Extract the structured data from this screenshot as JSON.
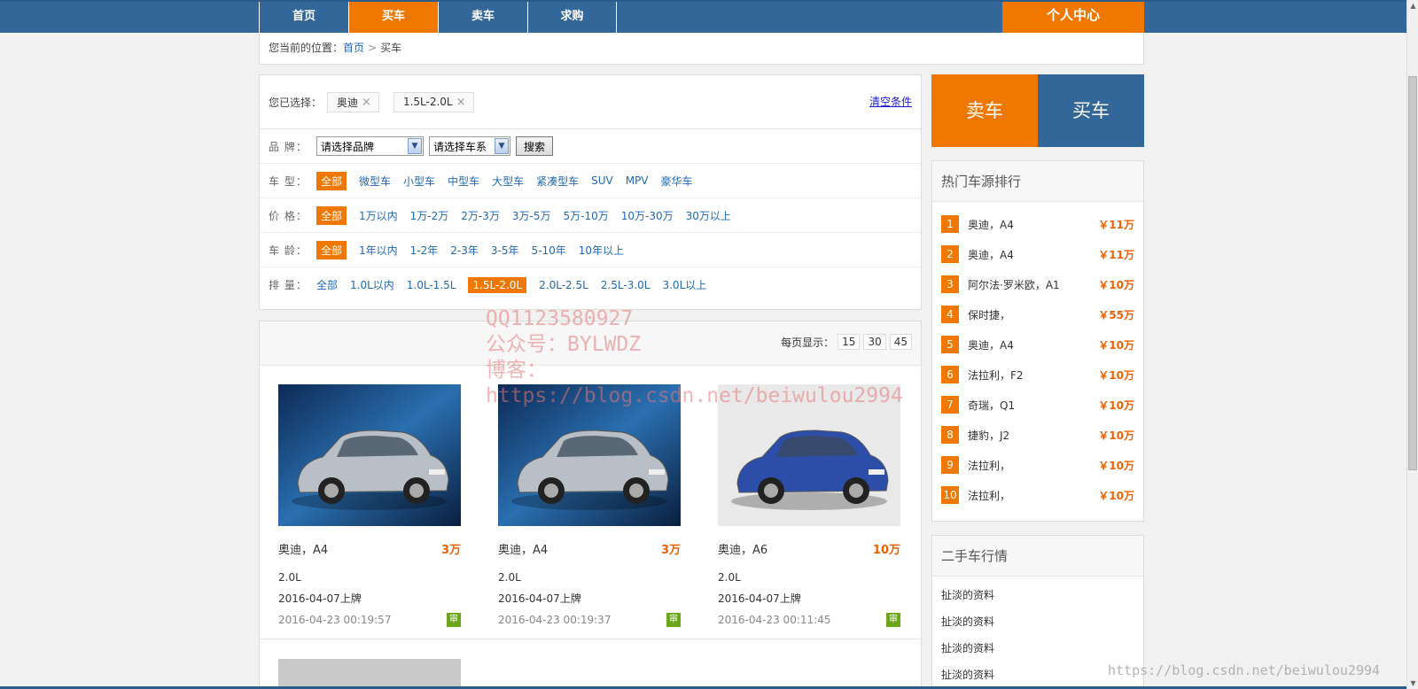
{
  "nav": {
    "items": [
      {
        "label": "首页",
        "active": false
      },
      {
        "label": "买车",
        "active": true
      },
      {
        "label": "卖车",
        "active": false
      },
      {
        "label": "求购",
        "active": false
      }
    ],
    "personal": "个人中心"
  },
  "breadcrumb": {
    "prefix": "您当前的位置：",
    "home": "首页",
    "sep": ">",
    "current": "买车"
  },
  "filter": {
    "selected_label": "您已选择：",
    "selected_tags": [
      "奥迪",
      "1.5L-2.0L"
    ],
    "remove_glyph": "×",
    "clear_label": "清空条件",
    "brand_label": "品 牌：",
    "brand_placeholder": "请选择品牌",
    "series_placeholder": "请选择车系",
    "search_label": "搜索",
    "rows": [
      {
        "label": "车 型：",
        "options": [
          "全部",
          "微型车",
          "小型车",
          "中型车",
          "大型车",
          "紧凑型车",
          "SUV",
          "MPV",
          "豪华车"
        ],
        "active": 0
      },
      {
        "label": "价 格：",
        "options": [
          "全部",
          "1万以内",
          "1万-2万",
          "2万-3万",
          "3万-5万",
          "5万-10万",
          "10万-30万",
          "30万以上"
        ],
        "active": 0
      },
      {
        "label": "车 龄：",
        "options": [
          "全部",
          "1年以内",
          "1-2年",
          "2-3年",
          "3-5年",
          "5-10年",
          "10年以上"
        ],
        "active": 0
      },
      {
        "label": "排 量：",
        "options": [
          "全部",
          "1.0L以内",
          "1.0L-1.5L",
          "1.5L-2.0L",
          "2.0L-2.5L",
          "2.5L-3.0L",
          "3.0L以上"
        ],
        "active": 3
      }
    ]
  },
  "listing": {
    "per_page_label": "每页显示：",
    "per_page_options": [
      "15",
      "30",
      "45"
    ],
    "cars": [
      {
        "name": "奥迪，A4",
        "price": "3万",
        "displacement": "2.0L",
        "registered": "2016-04-07上牌",
        "posted": "2016-04-23 00:19:57",
        "badge": "审",
        "color": "#b9bfc6"
      },
      {
        "name": "奥迪，A4",
        "price": "3万",
        "displacement": "2.0L",
        "registered": "2016-04-07上牌",
        "posted": "2016-04-23 00:19:37",
        "badge": "审",
        "color": "#b9bfc6"
      },
      {
        "name": "奥迪，A6",
        "price": "10万",
        "displacement": "2.0L",
        "registered": "2016-04-07上牌",
        "posted": "2016-04-23 00:11:45",
        "badge": "审",
        "color": "#2c4ea8"
      }
    ]
  },
  "side": {
    "sell_label": "卖车",
    "buy_label": "买车",
    "hot_title": "热门车源排行",
    "hot": [
      {
        "rank": "1",
        "name": "奥迪，A4",
        "price": "￥11万"
      },
      {
        "rank": "2",
        "name": "奥迪，A4",
        "price": "￥11万"
      },
      {
        "rank": "3",
        "name": "阿尔法·罗米欧，A1",
        "price": "￥10万"
      },
      {
        "rank": "4",
        "name": "保时捷，",
        "price": "￥55万"
      },
      {
        "rank": "5",
        "name": "奥迪，A4",
        "price": "￥10万"
      },
      {
        "rank": "6",
        "name": "法拉利，F2",
        "price": "￥10万"
      },
      {
        "rank": "7",
        "name": "奇瑞，Q1",
        "price": "￥10万"
      },
      {
        "rank": "8",
        "name": "捷豹，J2",
        "price": "￥10万"
      },
      {
        "rank": "9",
        "name": "法拉利，",
        "price": "￥10万"
      },
      {
        "rank": "10",
        "name": "法拉利，",
        "price": "￥10万"
      }
    ],
    "market_title": "二手车行情",
    "market": [
      "扯淡的资料",
      "扯淡的资料",
      "扯淡的资料",
      "扯淡的资料"
    ]
  },
  "watermark": {
    "lines": [
      "QQ1123580927",
      "公众号：BYLWDZ",
      "博客：",
      "https://blog.csdn.net/beiwulou2994"
    ],
    "corner": "https://blog.csdn.net/beiwulou2994"
  },
  "colors": {
    "accent": "#f07800",
    "nav": "#336699",
    "link": "#1f69b3",
    "price": "#f06000",
    "audit": "#6aa51a"
  }
}
